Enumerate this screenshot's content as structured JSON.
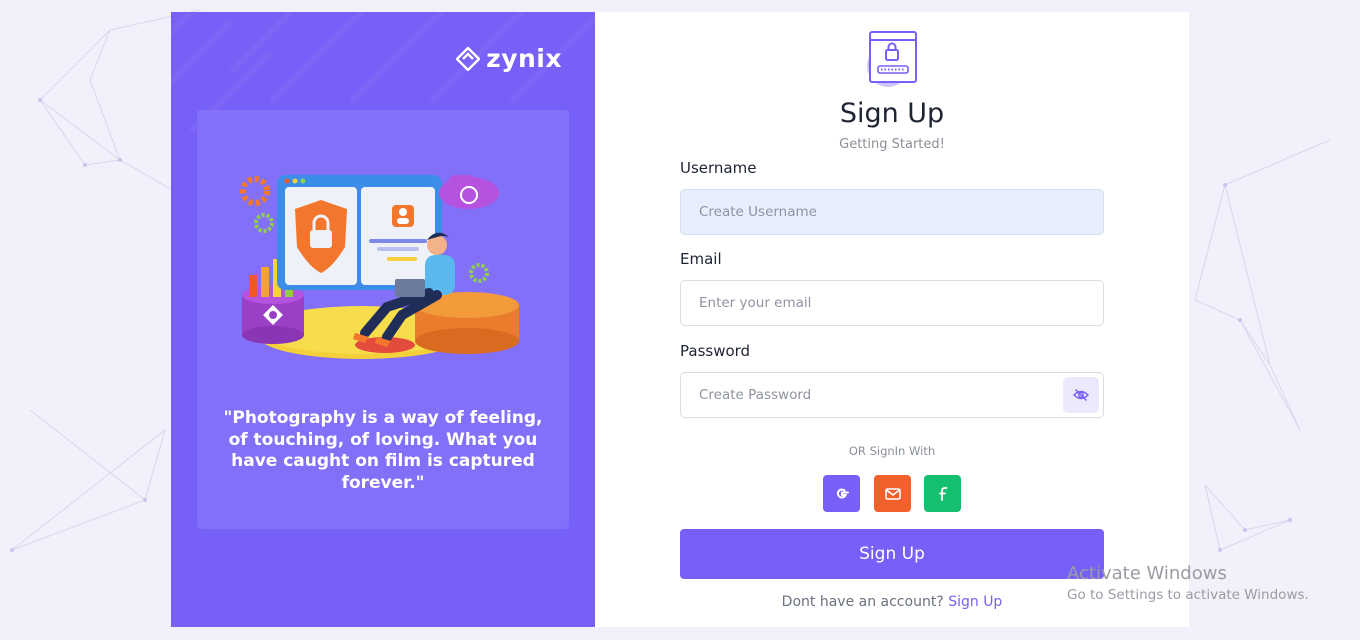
{
  "brand": {
    "name": "zynix",
    "logo_icon": "zynix-logo-icon"
  },
  "quote": "\"Photography is a way of feeling, of touching, of loving. What you have caught on film is captured forever.\"",
  "form": {
    "title": "Sign Up",
    "subtitle": "Getting Started!",
    "username": {
      "label": "Username",
      "placeholder": "Create Username"
    },
    "email": {
      "label": "Email",
      "placeholder": "Enter your email"
    },
    "password": {
      "label": "Password",
      "placeholder": "Create Password",
      "toggle_icon": "eye-off-icon"
    },
    "or_text": "OR SignIn With",
    "social": [
      {
        "name": "google",
        "icon": "google-icon",
        "color": "#7660f7"
      },
      {
        "name": "mail",
        "icon": "mail-icon",
        "color": "#f2602c"
      },
      {
        "name": "facebook",
        "icon": "facebook-icon",
        "color": "#14c06f"
      }
    ],
    "submit_label": "Sign Up",
    "footer_text": "Dont have an account?",
    "footer_link": "Sign Up"
  },
  "watermark": {
    "title": "Activate Windows",
    "subtitle": "Go to Settings to activate Windows."
  },
  "colors": {
    "primary": "#7660f7",
    "background": "#f1f0fb"
  }
}
